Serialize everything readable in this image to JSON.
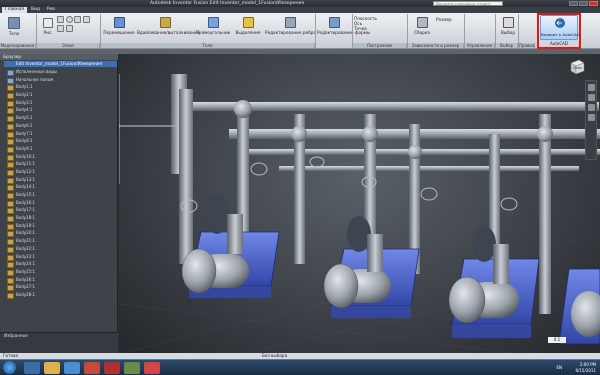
{
  "window": {
    "title": "Autodesk Inventor Fusion   Edit Inventor_model_1Fusion/Измерения",
    "search_placeholder": "Введите ключевое слово/фразу"
  },
  "tabs": [
    "Главная",
    "Вид",
    "Рев"
  ],
  "ribbon": {
    "panels": [
      {
        "name": "Моделирование",
        "label": "Тело"
      },
      {
        "name": "Эскиз",
        "label": "Рис."
      },
      {
        "name": "",
        "label": "Перемещение"
      },
      {
        "name": "",
        "label": "Вдавливание/выталкивание"
      },
      {
        "name": "Тело",
        "label": "Прямоугольник"
      },
      {
        "name": "",
        "label": "Выделение"
      },
      {
        "name": "",
        "label": "Редактирование ребра"
      },
      {
        "name": "Построение",
        "label": "Редактирование формы"
      },
      {
        "name": "Зависимости и размер",
        "label": "Сборка"
      },
      {
        "name": "Управление",
        "label": ""
      },
      {
        "name": "Выбор",
        "label": "Выбор"
      },
      {
        "name": "Правка",
        "label": ""
      }
    ],
    "small_buttons": [
      "Плоскость",
      "Ось",
      "Точка",
      "Размер"
    ],
    "acad_button": "Возврат к AutoCAD",
    "acad_panel": "AutoCAD"
  },
  "browser": {
    "title": "Браузер",
    "selected_node": "Edit Inventor_model_1Fusion/Измерения",
    "items": [
      "Исполненные виды",
      "Начальное полож",
      "Body1:1",
      "Body2:1",
      "Body3:1",
      "Body4:1",
      "Body5:1",
      "Body6:1",
      "Body7:1",
      "Body8:1",
      "Body9:1",
      "Body10:1",
      "Body11:1",
      "Body12:1",
      "Body13:1",
      "Body14:1",
      "Body15:1",
      "Body16:1",
      "Body17:1",
      "Body18:1",
      "Body19:1",
      "Body20:1",
      "Body21:1",
      "Body22:1",
      "Body23:1",
      "Body24:1",
      "Body25:1",
      "Body26:1",
      "Body27:1",
      "Body28:1"
    ],
    "bottom_label": "Избранное",
    "bottom_tab": "Избранное"
  },
  "viewcube_face": "Спер",
  "zoom_value": "0.1",
  "status": {
    "left": "Готово",
    "center": "Без выбора"
  },
  "taskbar": {
    "lang": "EN",
    "time": "2:00 PM",
    "date": "6/15/2011"
  },
  "colors": {
    "highlight": "#e01818",
    "selection": "#3c6fb5",
    "base_blue": "#4a62c8"
  }
}
